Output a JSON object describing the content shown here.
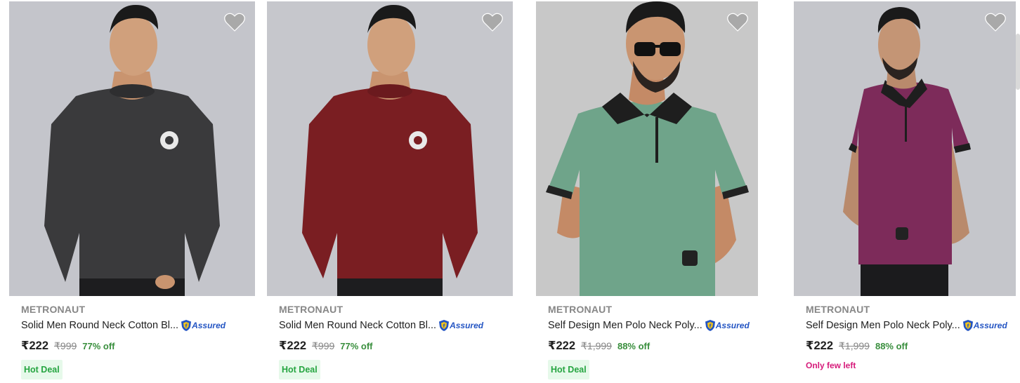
{
  "products": [
    {
      "brand": "METRONAUT",
      "title": "Solid Men Round Neck Cotton Bl...",
      "assured_label": "Assured",
      "price": "₹222",
      "mrp": "₹999",
      "discount": "77% off",
      "tag": "Hot Deal",
      "shirt_color": "#3a3a3c",
      "image_icon": "model-in-dark-grey-full-sleeve-tshirt"
    },
    {
      "brand": "METRONAUT",
      "title": "Solid Men Round Neck Cotton Bl...",
      "assured_label": "Assured",
      "price": "₹222",
      "mrp": "₹999",
      "discount": "77% off",
      "tag": "Hot Deal",
      "shirt_color": "#7a1e22",
      "image_icon": "model-in-maroon-full-sleeve-tshirt"
    },
    {
      "brand": "METRONAUT",
      "title": "Self Design Men Polo Neck Poly...",
      "assured_label": "Assured",
      "price": "₹222",
      "mrp": "₹1,999",
      "discount": "88% off",
      "tag": "Hot Deal",
      "shirt_color": "#6fa48a",
      "image_icon": "model-in-green-polo-tshirt"
    },
    {
      "brand": "METRONAUT",
      "title": "Self Design Men Polo Neck Poly...",
      "assured_label": "Assured",
      "price": "₹222",
      "mrp": "₹1,999",
      "discount": "88% off",
      "tag": "Only few left",
      "shirt_color": "#7d2b5a",
      "image_icon": "model-in-purple-polo-tshirt"
    }
  ],
  "colors": {
    "price_text": "#212121",
    "brand_text": "#878787",
    "discount_green": "#388e3c",
    "hot_deal_bg": "#e6f9ea",
    "hot_deal_text": "#26a541",
    "few_left_text": "#d61a7a",
    "assured_blue": "#2455c3",
    "wishlist_heart": "#a9a9a9"
  }
}
